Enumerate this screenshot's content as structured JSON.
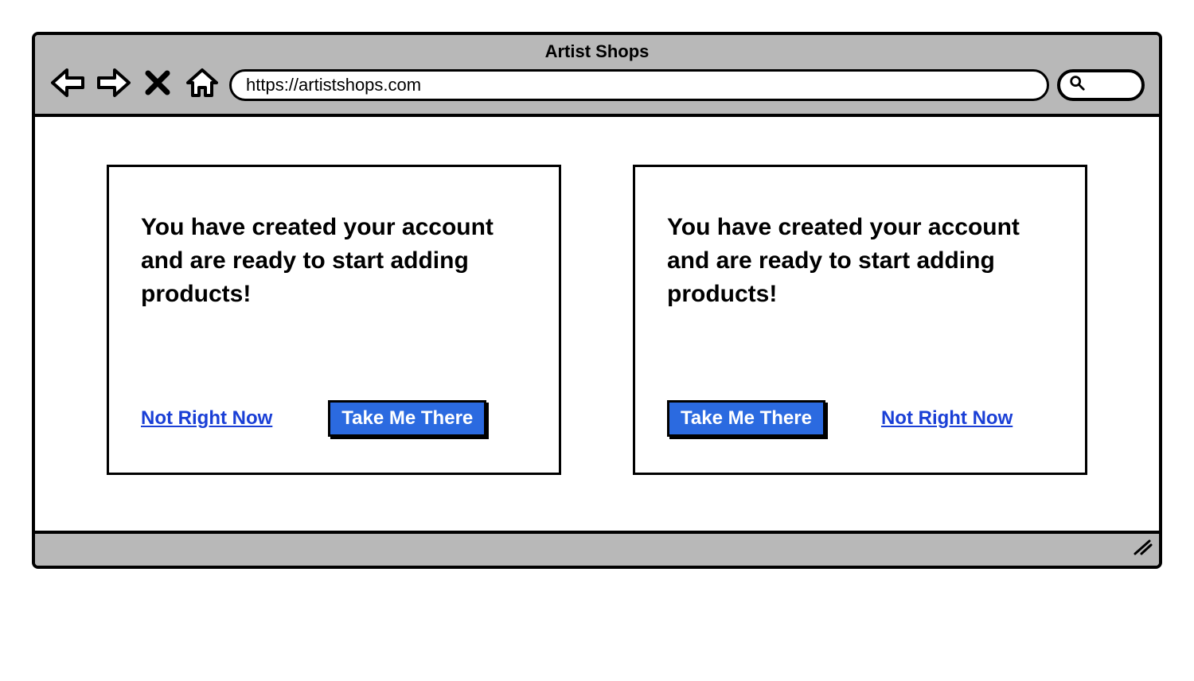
{
  "browser": {
    "title": "Artist Shops",
    "url": "https://artistshops.com"
  },
  "panels": [
    {
      "message": "You have created your account and are ready to start adding products!",
      "actions": [
        {
          "kind": "link",
          "label": "Not Right Now"
        },
        {
          "kind": "primary",
          "label": "Take Me There"
        }
      ]
    },
    {
      "message": "You have created your account and are ready to start adding products!",
      "actions": [
        {
          "kind": "primary",
          "label": "Take Me There"
        },
        {
          "kind": "link",
          "label": "Not Right Now"
        }
      ]
    }
  ]
}
